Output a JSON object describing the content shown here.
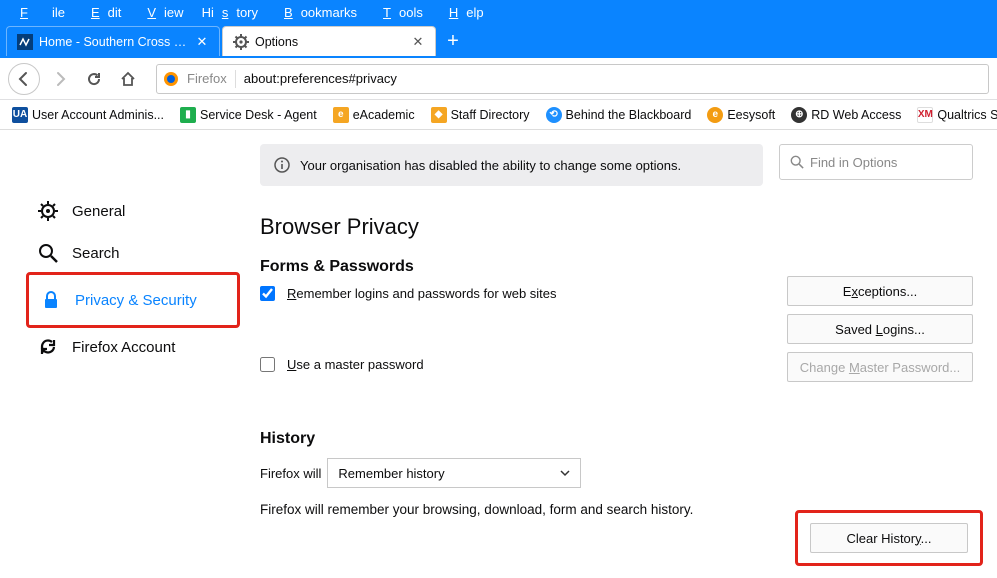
{
  "menu": {
    "file": "File",
    "edit": "Edit",
    "view": "View",
    "history": "History",
    "bookmarks": "Bookmarks",
    "tools": "Tools",
    "help": "Help"
  },
  "tabs": {
    "t1_title": "Home - Southern Cross Univer",
    "t2_title": "Options"
  },
  "urlbar": {
    "label": "Firefox",
    "url": "about:preferences#privacy"
  },
  "bookmarks": {
    "b1": "User Account Adminis...",
    "b2": "Service Desk - Agent",
    "b3": "eAcademic",
    "b4": "Staff Directory",
    "b5": "Behind the Blackboard",
    "b6": "Eesysoft",
    "b7": "RD Web Access",
    "b8": "Qualtrics Support"
  },
  "sidebar": {
    "general": "General",
    "search": "Search",
    "privacy": "Privacy & Security",
    "account": "Firefox Account"
  },
  "banner": "Your organisation has disabled the ability to change some options.",
  "find_ph": "Find in Options",
  "privacy": {
    "heading": "Browser Privacy",
    "forms_heading": "Forms & Passwords",
    "remember": "emember logins and passwords for web sites",
    "master": "se a master password",
    "exceptions": "Exceptions...",
    "saved": "Saved Logins...",
    "change_master": "Change Master Password...",
    "history_heading": "History",
    "firefox_will": "Firefox will",
    "dd_value": "Remember history",
    "desc": "Firefox will remember your browsing, download, form and search history.",
    "clear": "Clear History..."
  }
}
